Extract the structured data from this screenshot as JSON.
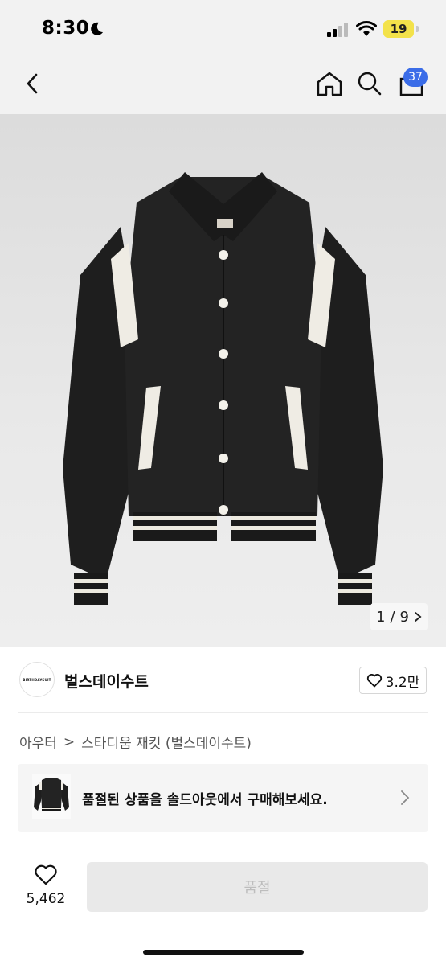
{
  "status_bar": {
    "time": "8:30",
    "battery": "19"
  },
  "nav": {
    "cart_count": "37"
  },
  "gallery": {
    "current": "1",
    "separator": "/",
    "total": "9"
  },
  "seller": {
    "avatar_text": "BIRTHDAYSUIT",
    "name": "벌스데이수트",
    "likes": "3.2만"
  },
  "breadcrumb": {
    "category": "아우터",
    "separator": ">",
    "product": "스타디움 재킷 (벌스데이수트)"
  },
  "banner": {
    "text": "품절된 상품을 솔드아웃에서 구매해보세요."
  },
  "bottom": {
    "favorite_count": "5,462",
    "buy_label": "품절"
  },
  "colors": {
    "accent_badge": "#3b6de8",
    "battery": "#f3e24a",
    "disabled_button": "#e9e9e9"
  },
  "icons": [
    "moon-icon",
    "signal-icon",
    "wifi-icon",
    "back-icon",
    "home-icon",
    "search-icon",
    "shopping-bag-icon",
    "chevron-right-icon",
    "heart-icon"
  ]
}
